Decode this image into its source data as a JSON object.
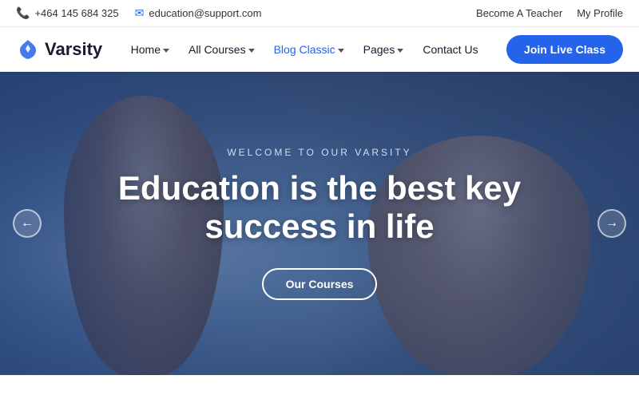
{
  "topbar": {
    "phone_icon": "📞",
    "phone_number": "+464 145 684 325",
    "email_icon": "✉",
    "email": "education@support.com",
    "become_teacher": "Become A Teacher",
    "my_profile": "My Profile"
  },
  "navbar": {
    "logo_text": "Varsity",
    "nav_items": [
      {
        "label": "Home",
        "has_dropdown": true
      },
      {
        "label": "All Courses",
        "has_dropdown": true
      },
      {
        "label": "Blog Classic",
        "has_dropdown": true
      },
      {
        "label": "Pages",
        "has_dropdown": true
      },
      {
        "label": "Contact Us",
        "has_dropdown": false
      }
    ],
    "join_button": "Join Live Class"
  },
  "hero": {
    "subtitle": "WELCOME TO OUR VARSITY",
    "title_line1": "Education is the best key",
    "title_line2": "success in life",
    "cta_button": "Our Courses",
    "prev_arrow": "←",
    "next_arrow": "→"
  }
}
